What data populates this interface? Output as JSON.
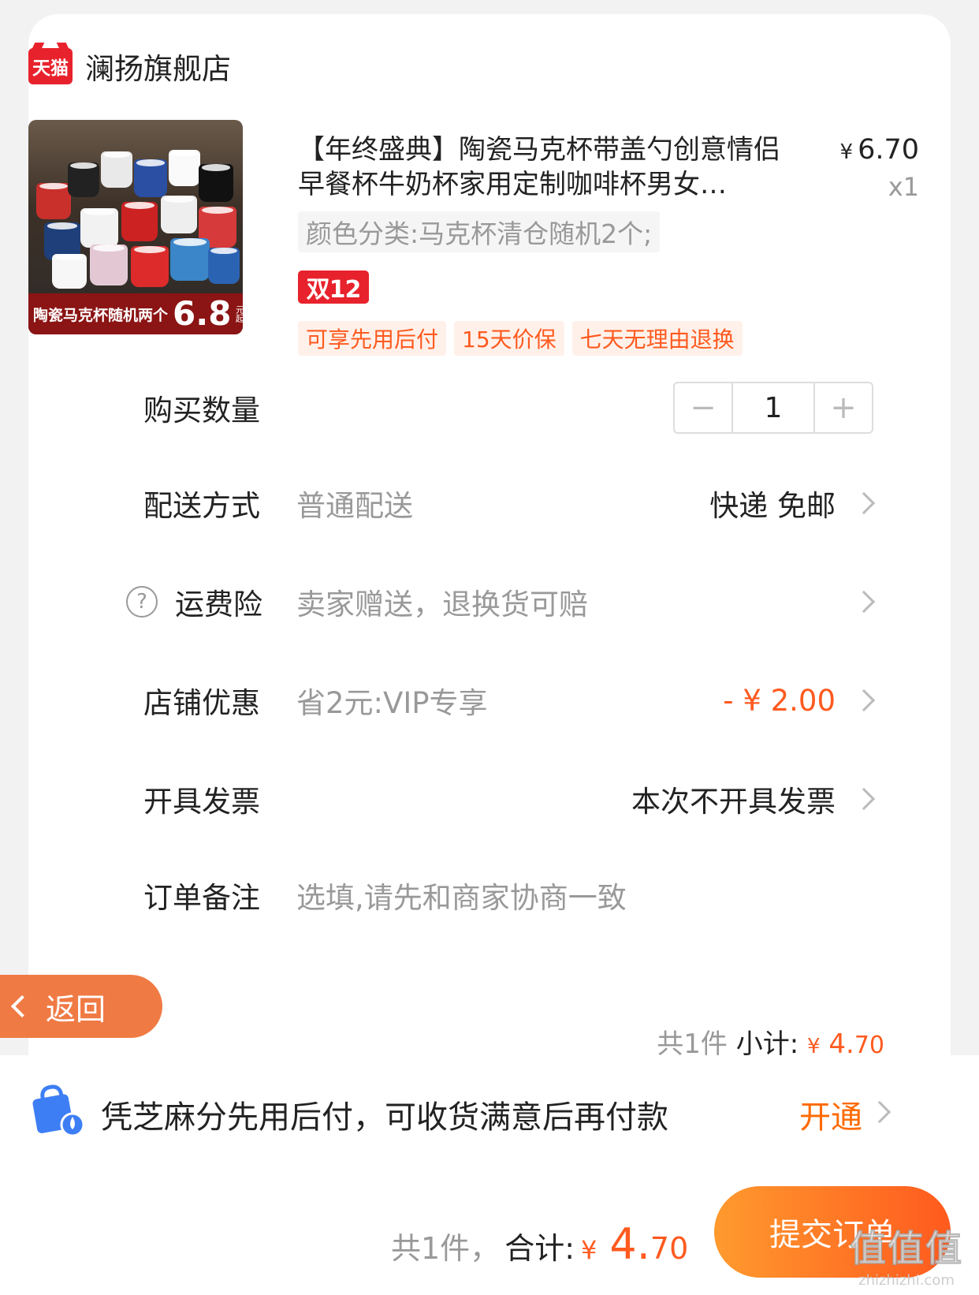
{
  "shop": {
    "logo_text": "天猫",
    "name": "澜扬旗舰店"
  },
  "product": {
    "title": "【年终盛典】陶瓷马克杯带盖勺创意情侣早餐杯牛奶杯家用定制咖啡杯男女…",
    "price_symbol": "¥",
    "price": "6.70",
    "quantity": "x1",
    "sku": "颜色分类:马克杯清仓随机2个;",
    "badge": "双12",
    "image_banner_text": "陶瓷马克杯随机两个",
    "image_banner_price": "6.8",
    "image_banner_unit": "元起",
    "service_tags": [
      "可享先用后付",
      "15天价保",
      "七天无理由退换"
    ]
  },
  "rows": {
    "quantity": {
      "label": "购买数量",
      "value": "1",
      "minus": "−",
      "plus": "+"
    },
    "delivery": {
      "label": "配送方式",
      "value": "普通配送",
      "right": "快递 免邮"
    },
    "shipping_insurance": {
      "label": "运费险",
      "help": "?",
      "value": "卖家赠送，退换货可赔"
    },
    "store_discount": {
      "label": "店铺优惠",
      "value": "省2元:VIP专享",
      "right": "- ¥ 2.00"
    },
    "invoice": {
      "label": "开具发票",
      "right": "本次不开具发票"
    },
    "remark": {
      "label": "订单备注",
      "placeholder": "选填,请先和商家协商一致"
    }
  },
  "subtotal": {
    "count": "共1件",
    "label": "小计:",
    "yen": "¥",
    "int": "4.",
    "dec": "70"
  },
  "back": {
    "label": "返回"
  },
  "pay_later": {
    "text": "凭芝麻分先用后付，可收货满意后再付款",
    "action": "开通"
  },
  "footer": {
    "count": "共1件，",
    "label": "合计:",
    "yen": "¥",
    "int": "4.",
    "dec": "70",
    "submit": "提交订单"
  },
  "watermark": {
    "main": "值值值",
    "sub": "zhizhizhi.com"
  },
  "colors": {
    "accent": "#ff5a1f",
    "tmall_red": "#e8222c",
    "back_button": "#f07a44",
    "pay_blue": "#3d7ef5"
  }
}
